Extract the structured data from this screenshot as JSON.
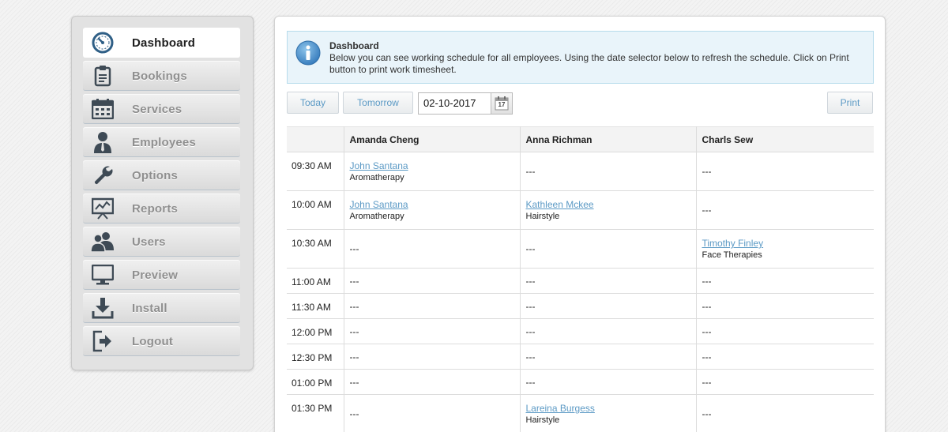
{
  "sidebar": {
    "items": [
      {
        "label": "Dashboard",
        "icon": "dashboard-gauge-icon",
        "active": true
      },
      {
        "label": "Bookings",
        "icon": "clipboard-icon"
      },
      {
        "label": "Services",
        "icon": "calendar-grid-icon"
      },
      {
        "label": "Employees",
        "icon": "person-icon"
      },
      {
        "label": "Options",
        "icon": "wrench-icon"
      },
      {
        "label": "Reports",
        "icon": "presentation-chart-icon"
      },
      {
        "label": "Users",
        "icon": "users-icon"
      },
      {
        "label": "Preview",
        "icon": "monitor-icon"
      },
      {
        "label": "Install",
        "icon": "download-icon"
      },
      {
        "label": "Logout",
        "icon": "logout-icon"
      }
    ]
  },
  "info": {
    "title": "Dashboard",
    "text": "Below you can see working schedule for all employees. Using the date selector below to refresh the schedule. Click on Print button to print work timesheet."
  },
  "toolbar": {
    "today_label": "Today",
    "tomorrow_label": "Tomorrow",
    "date_value": "02-10-2017",
    "calendar_day": "17",
    "print_label": "Print"
  },
  "schedule": {
    "headers": [
      "",
      "Amanda Cheng",
      "Anna Richman",
      "Charls Sew"
    ],
    "empty": "---",
    "rows": [
      {
        "time": "09:30 AM",
        "cells": [
          {
            "client": "John Santana",
            "service": "Aromatherapy"
          },
          null,
          null
        ]
      },
      {
        "time": "10:00 AM",
        "cells": [
          {
            "client": "John Santana",
            "service": "Aromatherapy"
          },
          {
            "client": "Kathleen Mckee",
            "service": "Hairstyle"
          },
          null
        ]
      },
      {
        "time": "10:30 AM",
        "cells": [
          null,
          null,
          {
            "client": "Timothy Finley",
            "service": "Face Therapies"
          }
        ]
      },
      {
        "time": "11:00 AM",
        "cells": [
          null,
          null,
          null
        ]
      },
      {
        "time": "11:30 AM",
        "cells": [
          null,
          null,
          null
        ]
      },
      {
        "time": "12:00 PM",
        "cells": [
          null,
          null,
          null
        ]
      },
      {
        "time": "12:30 PM",
        "cells": [
          null,
          null,
          null
        ]
      },
      {
        "time": "01:00 PM",
        "cells": [
          null,
          null,
          null
        ]
      },
      {
        "time": "01:30 PM",
        "cells": [
          null,
          {
            "client": "Lareina Burgess",
            "service": "Hairstyle"
          },
          null
        ]
      }
    ]
  },
  "colors": {
    "link": "#5c9ac5",
    "icon_dark": "#3e4a55",
    "info_bg": "#e9f4fa",
    "info_icon": "#4a90c8"
  }
}
